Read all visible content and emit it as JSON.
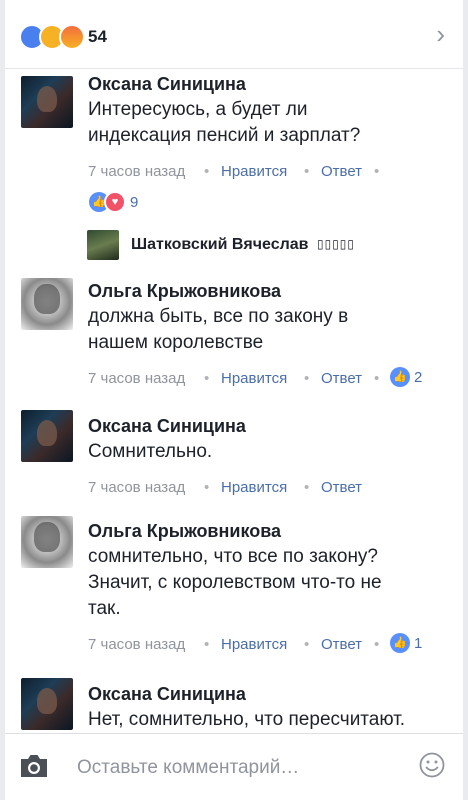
{
  "header": {
    "reaction_count": "54",
    "reactions": [
      "like-icon",
      "wow-icon",
      "angry-icon"
    ]
  },
  "comments": [
    {
      "author": "Оксана Синицина",
      "text_lines": [
        "Интересуюсь, а будет ли",
        "индексация пенсий и зарплат?"
      ],
      "time": "7 часов назад",
      "like_label": "Нравится",
      "reply_label": "Ответ",
      "reaction_count": "9"
    },
    {
      "author": "Ольга Крыжовникова",
      "text_lines": [
        "должна быть, все по закону в",
        "нашем королевстве"
      ],
      "time": "7 часов назад",
      "like_label": "Нравится",
      "reply_label": "Ответ",
      "reaction_count": "2"
    },
    {
      "author": "Оксана Синицина",
      "text_lines": [
        "Сомнительно."
      ],
      "time": "7 часов назад",
      "like_label": "Нравится",
      "reply_label": "Ответ"
    },
    {
      "author": "Ольга Крыжовникова",
      "text_lines": [
        "сомнительно, что все по закону?",
        "Значит, с королевством что-то не",
        "так."
      ],
      "time": "7 часов назад",
      "like_label": "Нравится",
      "reply_label": "Ответ",
      "reaction_count": "1"
    },
    {
      "author": "Оксана Синицина",
      "text_lines": [
        "Нет, сомнительно, что пересчитают."
      ]
    }
  ],
  "reply_prompt": {
    "author": "Шатковский Вячеслав",
    "suffix": "▯▯▯▯▯"
  },
  "composer": {
    "placeholder": "Оставьте комментарий…"
  },
  "colors": {
    "link": "#4b6ea9",
    "like_blue": "#5890ff",
    "heart_red": "#f25268",
    "meta_gray": "#90949c"
  }
}
